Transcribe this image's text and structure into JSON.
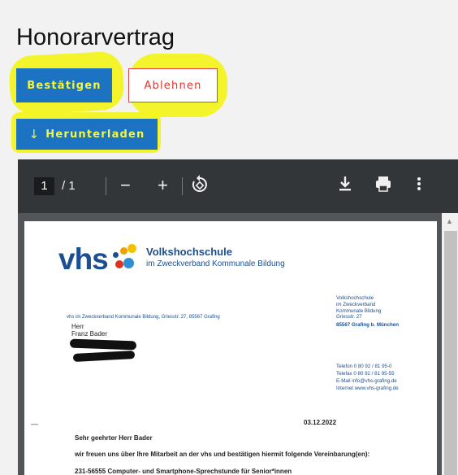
{
  "page": {
    "title": "Honorarvertrag"
  },
  "actions": {
    "confirm_label": "Bestätigen",
    "decline_label": "Ablehnen",
    "download_label": "Herunterladen"
  },
  "viewer": {
    "current_page": "1",
    "total_pages": "/ 1",
    "toolbar_icons": [
      "zoom-out-icon",
      "zoom-in-icon",
      "rotate-icon",
      "download-icon",
      "print-icon",
      "more-icon"
    ]
  },
  "document": {
    "logo": "vhs",
    "org_name": "Volkshochschule",
    "org_sub": "im Zweckverband Kommunale Bildung",
    "return_address": "vhs im Zweckverband Kommunale Bildung, Griesstr. 27, 85567 Grafing",
    "recipient_salutation": "Herr",
    "recipient_name": "Franz Bader",
    "sender_lines": [
      "Volkshochschule",
      "im Zweckverband",
      "Kommunale Bildung",
      "Griesstr. 27"
    ],
    "sender_city": "85567 Grafing b. München",
    "contact_lines": [
      "Telefon    0 80 92 / 81 95-0",
      "Telefax    0 80 92 / 81 95-55",
      "E-Mail     info@vhs-grafing.de",
      "Internet   www.vhs-grafing.de"
    ],
    "date": "03.12.2022",
    "greeting": "Sehr geehrter Herr Bader",
    "intro": "wir freuen uns über Ihre Mitarbeit an der vhs und bestätigen hiermit folgende Vereinbarung(en):",
    "course": "231-56555 Computer- und Smartphone-Sprechstunde für Senior*innen"
  },
  "colors": {
    "primary": "#1b73c1",
    "highlight": "#f4f41c",
    "danger": "#e4322b",
    "brand_blue": "#1c4f91",
    "toolbar": "#323639"
  }
}
